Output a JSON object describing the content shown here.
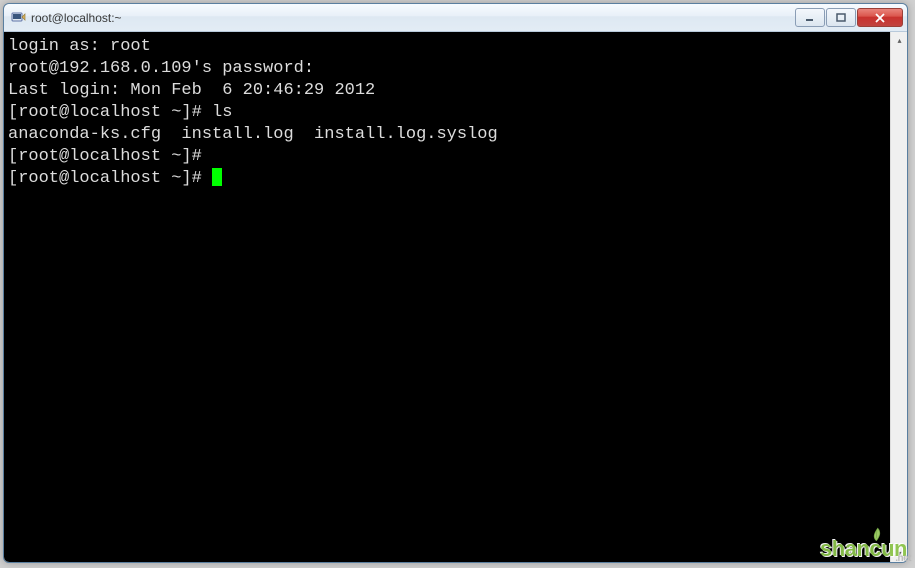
{
  "window": {
    "title": "root@localhost:~"
  },
  "terminal": {
    "lines": [
      {
        "text": "login as: root"
      },
      {
        "text": "root@192.168.0.109's password:"
      },
      {
        "text": "Last login: Mon Feb  6 20:46:29 2012"
      },
      {
        "prompt": "[root@localhost ~]# ",
        "cmd": "ls"
      },
      {
        "text": "anaconda-ks.cfg  install.log  install.log.syslog"
      },
      {
        "prompt": "[root@localhost ~]# ",
        "cmd": ""
      },
      {
        "prompt": "[root@localhost ~]# ",
        "cmd": "",
        "cursor": true
      }
    ]
  },
  "watermark": {
    "text": "shancun",
    "sub": ".net"
  }
}
